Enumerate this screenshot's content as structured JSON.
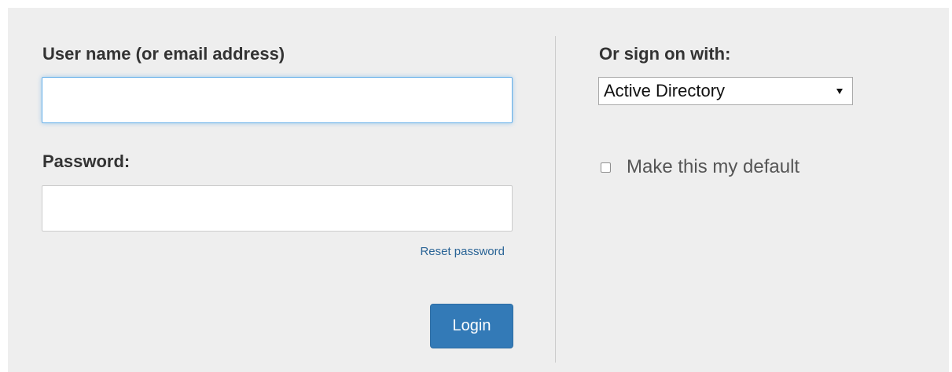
{
  "login_form": {
    "username_label": "User name (or email address)",
    "username_value": "",
    "password_label": "Password:",
    "password_value": "",
    "reset_password_link": "Reset password",
    "login_button": "Login"
  },
  "alt_signon": {
    "label": "Or sign on with:",
    "selected_provider": "Active Directory",
    "default_checkbox_label": "Make this my default",
    "default_checked": false
  },
  "colors": {
    "panel_background": "#eeeeee",
    "primary_button": "#337ab7",
    "link": "#2a6496",
    "focus_ring": "#66afe9"
  }
}
